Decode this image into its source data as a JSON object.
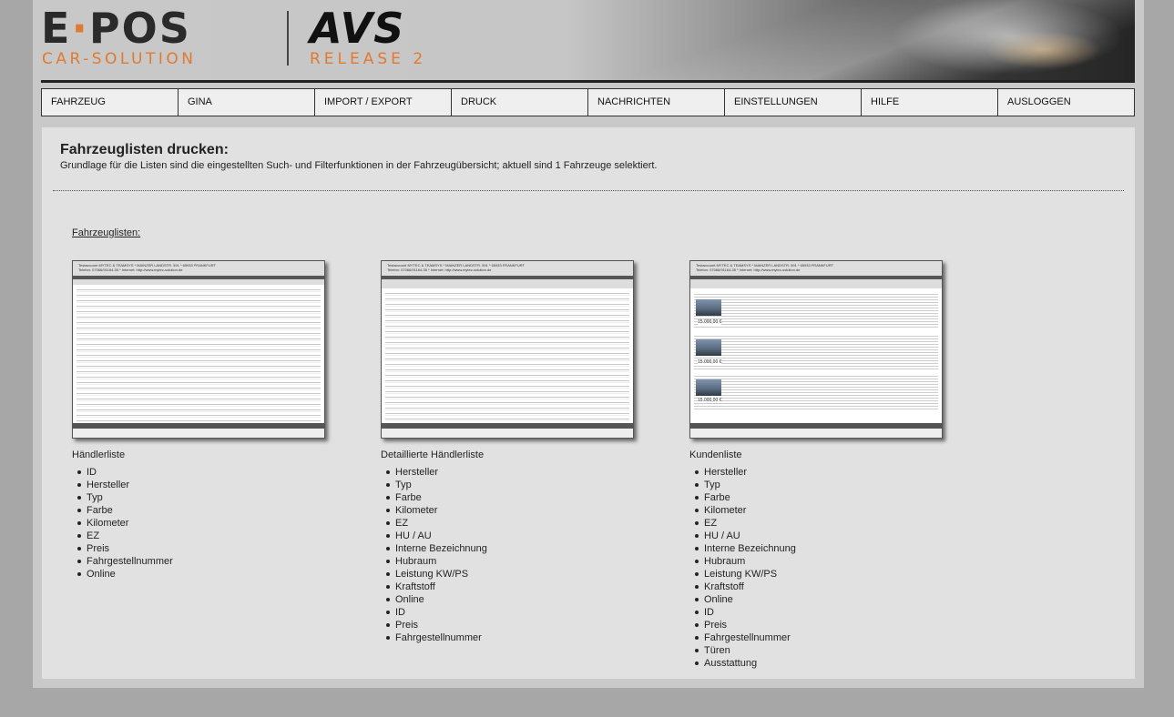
{
  "logo": {
    "epos_left": "E",
    "epos_dot": "·",
    "epos_right": "POS",
    "car_solution": "CAR-SOLUTION",
    "avs": "AVS",
    "release": "RELEASE 2"
  },
  "nav": {
    "items": [
      {
        "label": "FAHRZEUG"
      },
      {
        "label": "GINA"
      },
      {
        "label": "IMPORT / EXPORT"
      },
      {
        "label": "DRUCK"
      },
      {
        "label": "NACHRICHTEN"
      },
      {
        "label": "EINSTELLUNGEN"
      },
      {
        "label": "HILFE"
      },
      {
        "label": "AUSLOGGEN"
      }
    ]
  },
  "main": {
    "title": "Fahrzeuglisten drucken:",
    "subtitle": "Grundlage für die Listen sind die eingestellten Such- und Filterfunktionen in der Fahrzeugübersicht; aktuell sind 1 Fahrzeuge selektiert.",
    "section_label": "Fahrzeuglisten:"
  },
  "lists": [
    {
      "title": "Händlerliste",
      "fields": [
        "ID",
        "Hersteller",
        "Typ",
        "Farbe",
        "Kilometer",
        "EZ",
        "Preis",
        "Fahrgestellnummer",
        "Online"
      ]
    },
    {
      "title": "Detaillierte Händlerliste",
      "fields": [
        "Hersteller",
        "Typ",
        "Farbe",
        "Kilometer",
        "EZ",
        "HU / AU",
        "Interne Bezeichnung",
        "Hubraum",
        "Leistung KW/PS",
        "Kraftstoff",
        "Online",
        "ID",
        "Preis",
        "Fahrgestellnummer"
      ]
    },
    {
      "title": "Kundenliste",
      "fields": [
        "Hersteller",
        "Typ",
        "Farbe",
        "Kilometer",
        "EZ",
        "HU / AU",
        "Interne Bezeichnung",
        "Hubraum",
        "Leistung KW/PS",
        "Kraftstoff",
        "Online",
        "ID",
        "Preis",
        "Fahrgestellnummer",
        "Türen",
        "Ausstattung"
      ]
    }
  ],
  "thumbs": {
    "header_text": "Testaccount MYTEC & TEAMSYS * MAINZER LANDSTR. 591 * 65933 FRANKFURT",
    "phone_text": "Telefon: 07066/91164-35 * Internet: http://www.mytec-solution.de",
    "price": "15.000,00 €"
  }
}
